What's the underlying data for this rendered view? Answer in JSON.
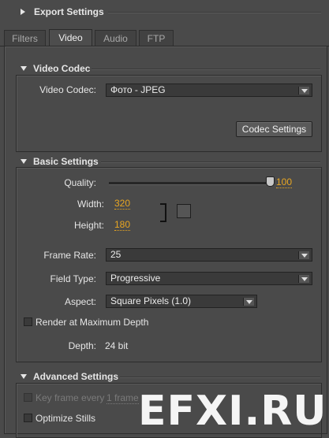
{
  "export_settings": {
    "title": "Export Settings"
  },
  "tabs": [
    {
      "label": "Filters"
    },
    {
      "label": "Video"
    },
    {
      "label": "Audio"
    },
    {
      "label": "FTP"
    }
  ],
  "video_codec_section": {
    "title": "Video Codec",
    "codec_label": "Video Codec:",
    "codec_value": "Фото - JPEG",
    "codec_settings_button": "Codec Settings"
  },
  "basic_settings": {
    "title": "Basic Settings",
    "quality_label": "Quality:",
    "quality_value": "100",
    "width_label": "Width:",
    "width_value": "320",
    "height_label": "Height:",
    "height_value": "180",
    "frame_rate_label": "Frame Rate:",
    "frame_rate_value": "25",
    "field_type_label": "Field Type:",
    "field_type_value": "Progressive",
    "aspect_label": "Aspect:",
    "aspect_value": "Square Pixels (1.0)",
    "render_max_depth_label": "Render at Maximum Depth",
    "depth_label": "Depth:",
    "depth_value": "24 bit"
  },
  "advanced_settings": {
    "title": "Advanced Settings",
    "key_frame_label": "Key frame every",
    "key_frame_value": "1 frame",
    "optimize_stills_label": "Optimize Stills"
  },
  "watermark": {
    "text": "EFXI.RU"
  }
}
